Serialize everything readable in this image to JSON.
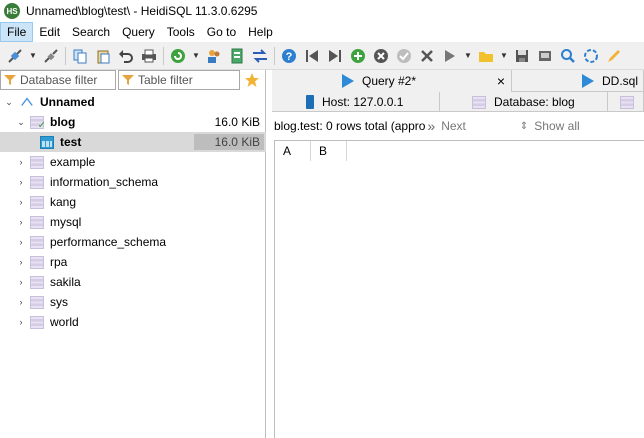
{
  "window": {
    "title": "Unnamed\\blog\\test\\ - HeidiSQL 11.3.0.6295",
    "app_icon_text": "HS"
  },
  "menu": [
    "File",
    "Edit",
    "Search",
    "Query",
    "Tools",
    "Go to",
    "Help"
  ],
  "toolbar": {
    "icons": [
      "connect-icon",
      "disconnect-icon",
      "copy-icon",
      "paste-icon",
      "undo-icon",
      "print-icon",
      "refresh-icon",
      "user-manager-icon",
      "export-icon",
      "transfer-icon",
      "help-icon",
      "first-icon",
      "last-icon",
      "add-icon",
      "cancel-icon",
      "confirm-icon",
      "clear-icon",
      "run-icon",
      "open-folder-icon",
      "save-icon",
      "print-preview-icon",
      "find-icon",
      "replace-icon",
      "pencil-icon"
    ]
  },
  "filters": {
    "database_placeholder": "Database filter",
    "table_placeholder": "Table filter"
  },
  "tree": {
    "root": "Unnamed",
    "blog": {
      "label": "blog",
      "size": "16.0 KiB"
    },
    "test": {
      "label": "test",
      "size": "16.0 KiB"
    },
    "databases": [
      "example",
      "information_schema",
      "kang",
      "mysql",
      "performance_schema",
      "rpa",
      "sakila",
      "sys",
      "world"
    ]
  },
  "tabs": {
    "query_tab": "Query #2*",
    "close_glyph": "×",
    "file_tab": "DD.sql",
    "host_tab": "Host: 127.0.0.1",
    "database_tab": "Database: blog"
  },
  "result": {
    "status": "blog.test: 0 rows total (appro",
    "next_label": "Next",
    "show_all_label": "Show all",
    "columns": [
      "A",
      "B"
    ]
  },
  "colors": {
    "accent": "#2d8ad6",
    "selection": "#d9d9d9",
    "toolbar_bg": "#f0f0f0"
  }
}
